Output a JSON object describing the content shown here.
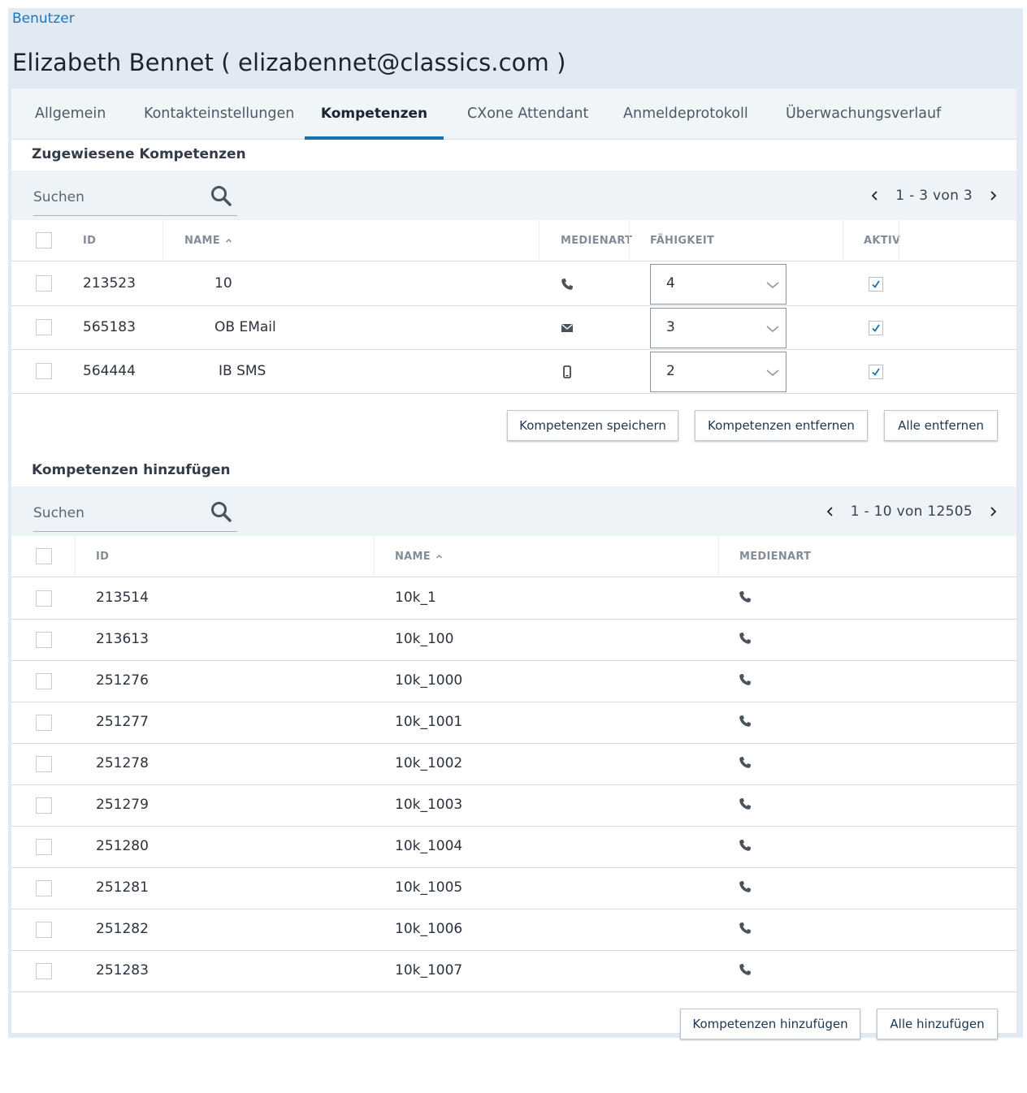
{
  "breadcrumb": "Benutzer",
  "title": "Elizabeth Bennet ( elizabennet@classics.com )",
  "tabs": [
    "Allgemein",
    "Kontakteinstellungen",
    "Kompetenzen",
    "CXone Attendant",
    "Anmeldeprotokoll",
    "Überwachungsverlauf"
  ],
  "active_tab": "Kompetenzen",
  "assigned": {
    "title": "Zugewiesene Kompetenzen",
    "search_placeholder": "Suchen",
    "pager": "1 - 3 von 3",
    "columns": {
      "id": "ID",
      "name": "NAME",
      "media": "MEDIENART",
      "skill": "FÄHIGKEIT",
      "active": "AKTIV"
    },
    "rows": [
      {
        "id": "213523",
        "name": "10",
        "media": "phone-icon",
        "skill": "4",
        "active": true
      },
      {
        "id": "565183",
        "name": "OB EMail",
        "media": "envelope-icon",
        "skill": "3",
        "active": true
      },
      {
        "id": "564444",
        "name": "IB SMS",
        "media": "mobile-icon",
        "skill": "2",
        "active": true
      }
    ],
    "buttons": {
      "save": "Kompetenzen speichern",
      "remove": "Kompetenzen entfernen",
      "remove_all": "Alle entfernen"
    }
  },
  "add": {
    "title": "Kompetenzen hinzufügen",
    "search_placeholder": "Suchen",
    "pager": "1 - 10 von 12505",
    "columns": {
      "id": "ID",
      "name": "NAME",
      "media": "MEDIENART"
    },
    "rows": [
      {
        "id": "213514",
        "name": "10k_1",
        "media": "phone-icon"
      },
      {
        "id": "213613",
        "name": "10k_100",
        "media": "phone-icon"
      },
      {
        "id": "251276",
        "name": "10k_1000",
        "media": "phone-icon"
      },
      {
        "id": "251277",
        "name": "10k_1001",
        "media": "phone-icon"
      },
      {
        "id": "251278",
        "name": "10k_1002",
        "media": "phone-icon"
      },
      {
        "id": "251279",
        "name": "10k_1003",
        "media": "phone-icon"
      },
      {
        "id": "251280",
        "name": "10k_1004",
        "media": "phone-icon"
      },
      {
        "id": "251281",
        "name": "10k_1005",
        "media": "phone-icon"
      },
      {
        "id": "251282",
        "name": "10k_1006",
        "media": "phone-icon"
      },
      {
        "id": "251283",
        "name": "10k_1007",
        "media": "phone-icon"
      }
    ],
    "buttons": {
      "add": "Kompetenzen hinzufügen",
      "add_all": "Alle hinzufügen"
    }
  },
  "colors": {
    "accent": "#0f73b6",
    "link": "#1a78c2",
    "frame": "#e1e9f2",
    "toolbar": "#eef3f7"
  }
}
